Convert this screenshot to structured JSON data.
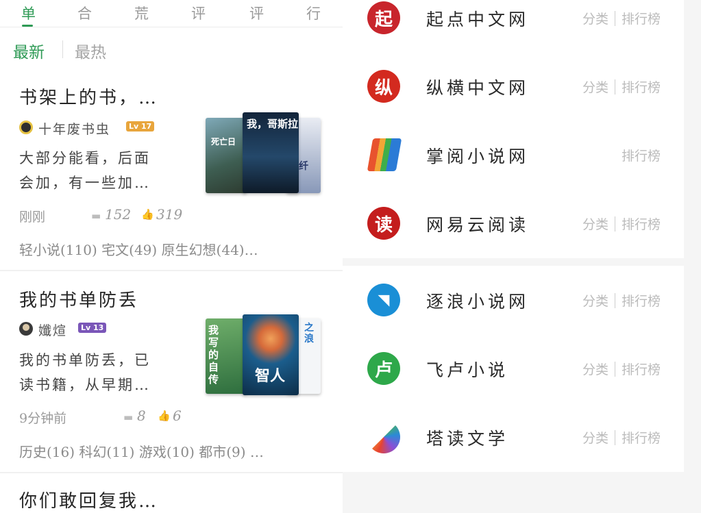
{
  "tabs": [
    "单",
    "合",
    "荒",
    "评",
    "评",
    "行"
  ],
  "sort": {
    "latest": "最新",
    "hottest": "最热"
  },
  "lists": [
    {
      "title": "书架上的书，…",
      "author": "十年废书虫",
      "level": "17",
      "level_color": "#e8a53c",
      "desc_line1": "大部分能看，后面",
      "desc_line2": "会加，有一些加…",
      "time": "刚刚",
      "comments": "152",
      "likes": "319",
      "tags": "轻小说(110) 宅文(49) 原生幻想(44)…",
      "covers": [
        {
          "text": "死亡日",
          "color": "#5a7d8f"
        },
        {
          "text": "我，哥斯拉",
          "color": "#1f3650"
        },
        {
          "text": "了纤",
          "color": "#8898b8"
        }
      ]
    },
    {
      "title": "我的书单防丢",
      "author": "孅煊",
      "level": "13",
      "level_color": "#7a56b8",
      "desc_line1": "我的书单防丢，已",
      "desc_line2": "读书籍，从早期…",
      "time": "9分钟前",
      "comments": "8",
      "likes": "6",
      "tags": "历史(16) 科幻(11) 游戏(10) 都市(9) …",
      "covers": [
        {
          "text": "我写的自传",
          "color": "#3f8a50"
        },
        {
          "text": "智人",
          "color": "#1b5d8c"
        },
        {
          "text": "之浪",
          "color": "#d8dde3"
        }
      ]
    },
    {
      "title": "你们敢回复我…"
    }
  ],
  "sites": [
    {
      "name": "起点中文网",
      "logo": "起",
      "color": "#c8252c",
      "cat": "分类",
      "rank": "排行榜"
    },
    {
      "name": "纵横中文网",
      "logo": "纵",
      "color": "#d32a1f",
      "cat": "分类",
      "rank": "排行榜"
    },
    {
      "name": "掌阅小说网",
      "logo": "",
      "color": "#e8532e",
      "cat": "",
      "rank": "排行榜"
    },
    {
      "name": "网易云阅读",
      "logo": "读",
      "color": "#c41d1d",
      "cat": "分类",
      "rank": "排行榜"
    },
    {
      "name": "逐浪小说网",
      "logo": "",
      "color": "#1a8fd6",
      "cat": "分类",
      "rank": "排行榜"
    },
    {
      "name": "飞卢小说",
      "logo": "卢",
      "color": "#2ea84a",
      "cat": "分类",
      "rank": "排行榜"
    },
    {
      "name": "塔读文学",
      "logo": "",
      "color": "#f3a33a",
      "cat": "分类",
      "rank": "排行榜"
    }
  ]
}
